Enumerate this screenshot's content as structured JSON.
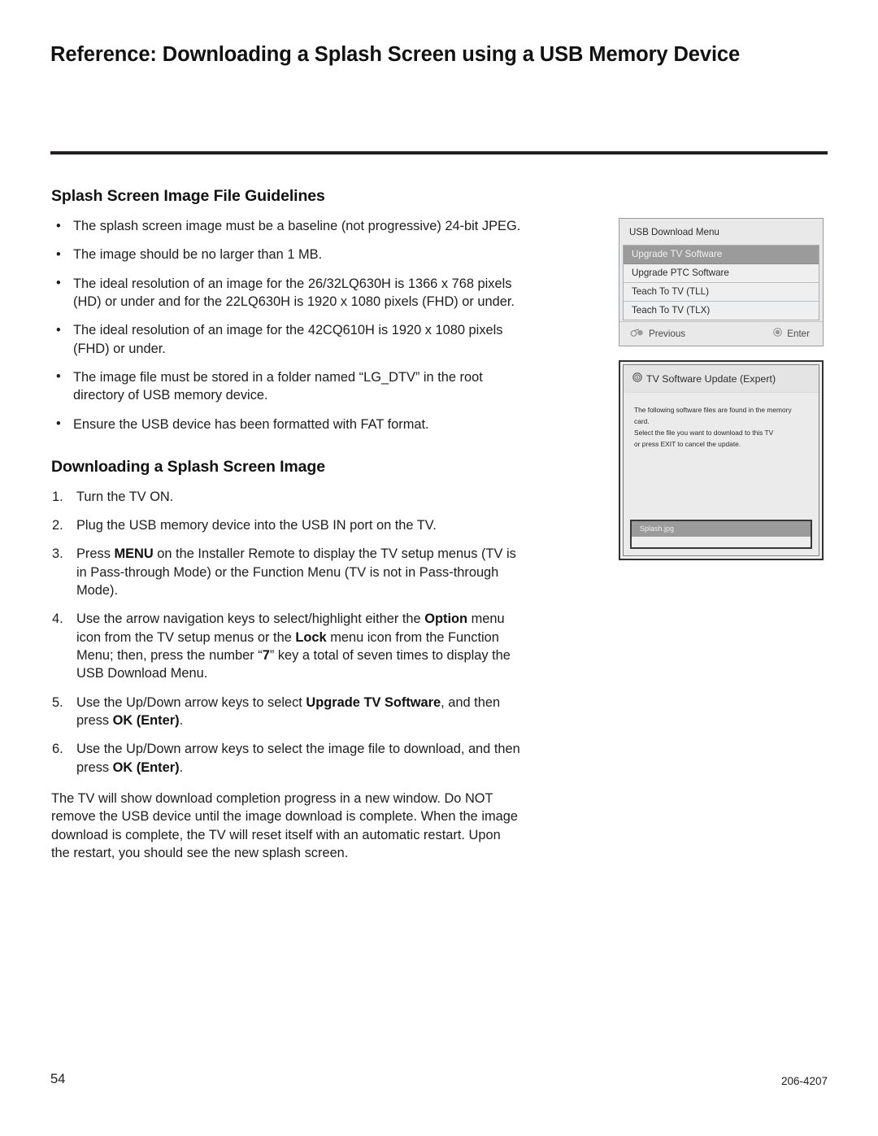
{
  "header": {
    "title": "Reference: Downloading a Splash Screen using a USB Memory Device"
  },
  "guidelines": {
    "heading": "Splash Screen Image File Guidelines",
    "bullet_marker": "•",
    "items": [
      "The splash screen image must be a baseline (not progressive) 24-bit JPEG.",
      "The image should be no larger than 1 MB.",
      "The ideal resolution of an image for the 26/32LQ630H is 1366 x 768 pixels (HD) or under and for the 22LQ630H is 1920 x 1080 pixels (FHD) or under.",
      "The ideal resolution of an image for the 42CQ610H is 1920 x 1080 pixels (FHD) or under.",
      "The image file must be stored in a folder named “LG_DTV” in the root directory of USB memory device.",
      "Ensure the USB device has been formatted with FAT format."
    ]
  },
  "downloading": {
    "heading": "Downloading a Splash Screen Image",
    "steps": [
      {
        "num": "1.",
        "text": "Turn the TV ON."
      },
      {
        "num": "2.",
        "text": "Plug the USB memory device into the USB IN port on the TV."
      },
      {
        "num": "3.",
        "text": "Press MENU on the Installer Remote to display the TV setup menus (TV is in Pass-through Mode) or the Function Menu (TV is not in Pass-through Mode)."
      },
      {
        "num": "4.",
        "text": "Use the arrow navigation keys to select/highlight either the Option menu icon from the TV setup menus or the Lock menu icon from the Function Menu; then, press the number “7” key a total of seven times to display the USB Download Menu."
      },
      {
        "num": "5.",
        "text": "Use the Up/Down arrow keys to select Upgrade TV Software, and then press OK (Enter)."
      },
      {
        "num": "6.",
        "text": "Use the Up/Down arrow keys to select the image file to download, and then press OK (Enter)."
      }
    ],
    "closing": "The TV will show download completion progress in a new window. Do NOT remove the USB device until the image download is complete. When the image download is complete, the TV will reset itself with an automatic restart. Upon the restart, you should see the new splash screen."
  },
  "usb_download_menu": {
    "title": "USB Download Menu",
    "items": [
      {
        "label": "Upgrade TV Software",
        "selected": true
      },
      {
        "label": "Upgrade PTC Software",
        "selected": false
      },
      {
        "label": "Teach To TV (TLL)",
        "selected": false
      },
      {
        "label": "Teach To TV (TLX)",
        "selected": false
      }
    ],
    "previous_label": "Previous",
    "enter_label": "Enter",
    "previous_icon": "back-arrow-icon",
    "enter_icon": "ok-button-icon",
    "highlight_color": "#9b9b9b",
    "panel_background": "#e9e9e9"
  },
  "tv_software_update": {
    "title": "TV Software Update (Expert)",
    "title_icon": "info-circle-icon",
    "body_lines": [
      "The following software files are found in the memory card.",
      "Select the file you want to download to this TV",
      "or press EXIT to cancel the update."
    ],
    "file_list": [
      {
        "name": "Splash.jpg",
        "selected": true
      }
    ],
    "highlight_color": "#9b9b9b",
    "panel_background": "#ebebeb"
  },
  "footer": {
    "page_number": "54",
    "document_code": "206-4207"
  }
}
